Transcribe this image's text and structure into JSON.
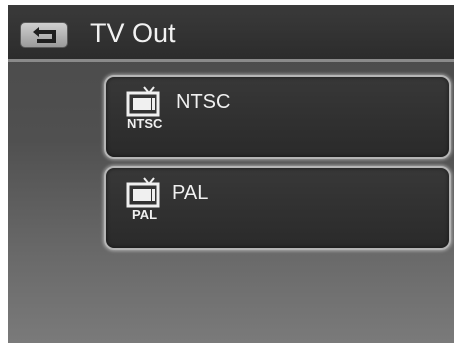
{
  "header": {
    "title": "TV Out",
    "back_icon": "back-arrow-icon"
  },
  "options": [
    {
      "label": "NTSC",
      "icon_text": "NTSC",
      "icon": "tv-icon"
    },
    {
      "label": "PAL",
      "icon_text": "PAL",
      "icon": "tv-icon"
    }
  ],
  "colors": {
    "background": "#555555",
    "titlebar": "#2e2e2e",
    "button_border": "#b5b5b5",
    "text": "#f0f0f0"
  }
}
